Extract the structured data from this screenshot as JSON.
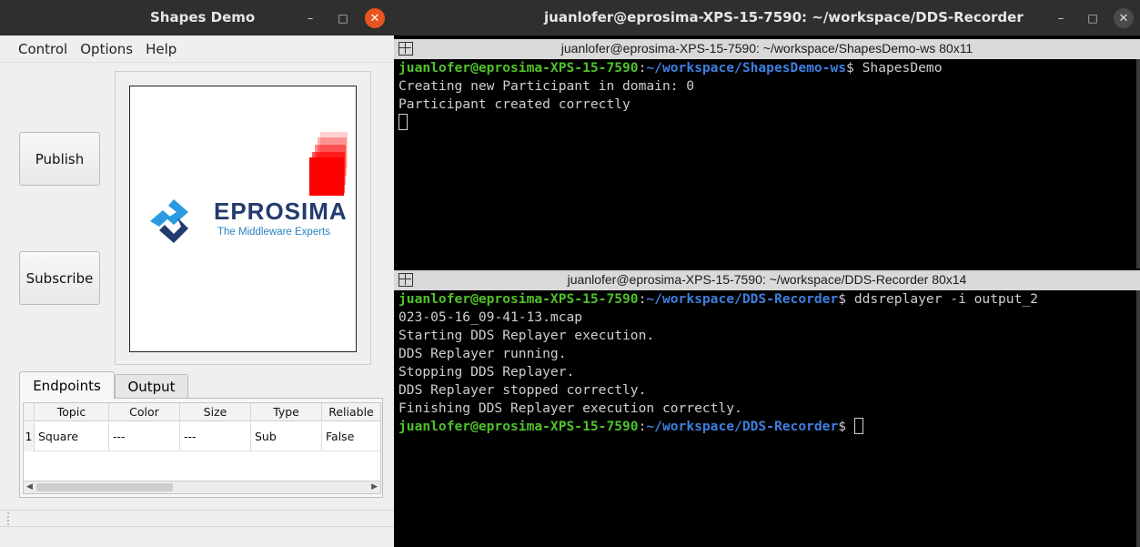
{
  "shapes_window": {
    "title": "Shapes Demo",
    "minimize_glyph": "–",
    "maximize_glyph": "□",
    "close_glyph": "✕",
    "menu": [
      "Control",
      "Options",
      "Help"
    ],
    "publish_label": "Publish",
    "subscribe_label": "Subscribe",
    "logo": {
      "name": "eProsima",
      "name_display": "EPROSIMA",
      "tagline": "The Middleware Experts"
    },
    "tabs": [
      "Endpoints",
      "Output"
    ],
    "table": {
      "columns": [
        "Topic",
        "Color",
        "Size",
        "Type",
        "Reliable"
      ],
      "rows": [
        {
          "num": "1",
          "topic": "Square",
          "color": "---",
          "size": "---",
          "type": "Sub",
          "reliable": "False"
        }
      ]
    },
    "shape_color": "#ff0000"
  },
  "terminal_window": {
    "title": "juanlofer@eprosima-XPS-15-7590: ~/workspace/DDS-Recorder",
    "minimize_glyph": "–",
    "maximize_glyph": "□",
    "close_glyph": "✕",
    "top_pane": {
      "header": "juanlofer@eprosima-XPS-15-7590: ~/workspace/ShapesDemo-ws 80x11",
      "prompt_user": "juanlofer@eprosima-XPS-15-7590",
      "prompt_path": "~/workspace/ShapesDemo-ws",
      "command": "ShapesDemo",
      "output": [
        "Creating new Participant in domain: 0",
        "Participant created correctly"
      ]
    },
    "bottom_pane": {
      "header": "juanlofer@eprosima-XPS-15-7590: ~/workspace/DDS-Recorder 80x14",
      "prompt_user": "juanlofer@eprosima-XPS-15-7590",
      "prompt_path": "~/workspace/DDS-Recorder",
      "command_line1": "ddsreplayer -i output_2",
      "command_line2": "023-05-16_09-41-13.mcap",
      "output": [
        "Starting DDS Replayer execution.",
        "DDS Replayer running.",
        "Stopping DDS Replayer.",
        "DDS Replayer stopped correctly.",
        "Finishing DDS Replayer execution correctly."
      ]
    },
    "prompt_user_color": "#4fc22a",
    "prompt_path_color": "#3f7fe0"
  }
}
